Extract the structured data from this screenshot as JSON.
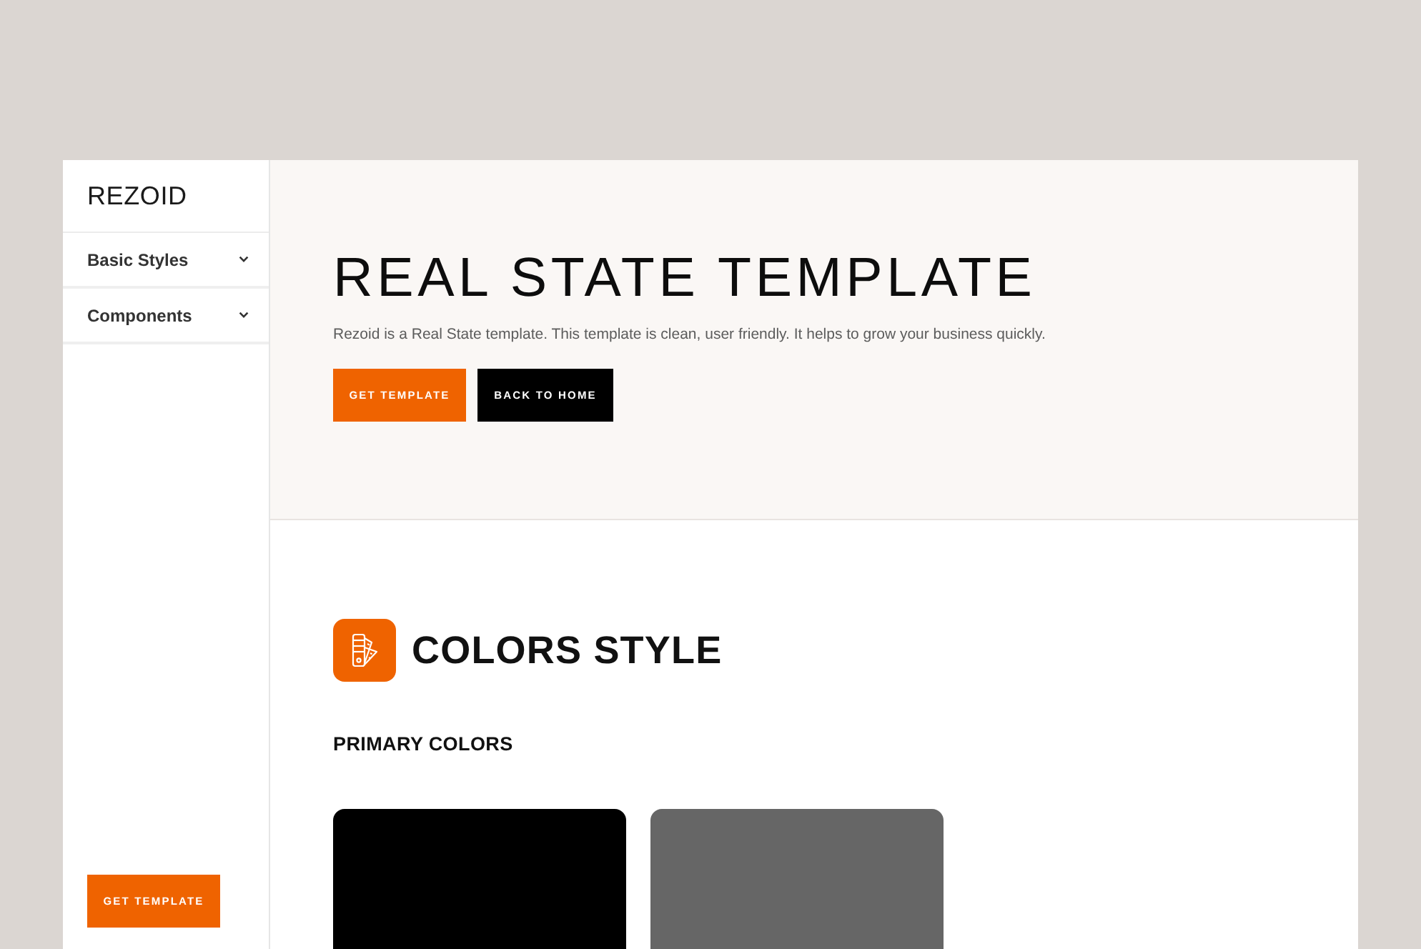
{
  "sidebar": {
    "logo": "REZOID",
    "items": [
      {
        "label": "Basic Styles",
        "expanded": false
      },
      {
        "label": "Components",
        "expanded": false
      }
    ],
    "button": "GET TEMPLATE"
  },
  "hero": {
    "title": "REAL STATE TEMPLATE",
    "text": "Rezoid is a Real State template. This template is clean, user friendly. It helps to grow your business quickly.",
    "buttons": [
      {
        "label": "GET TEMPLATE",
        "kind": "primary"
      },
      {
        "label": "BACK TO HOME",
        "kind": "dark"
      }
    ]
  },
  "colors_section": {
    "title": "COLORS STYLE",
    "subtitle": "PRIMARY COLORS",
    "swatches": [
      {
        "color": "#000000"
      },
      {
        "color": "#666666"
      }
    ]
  }
}
